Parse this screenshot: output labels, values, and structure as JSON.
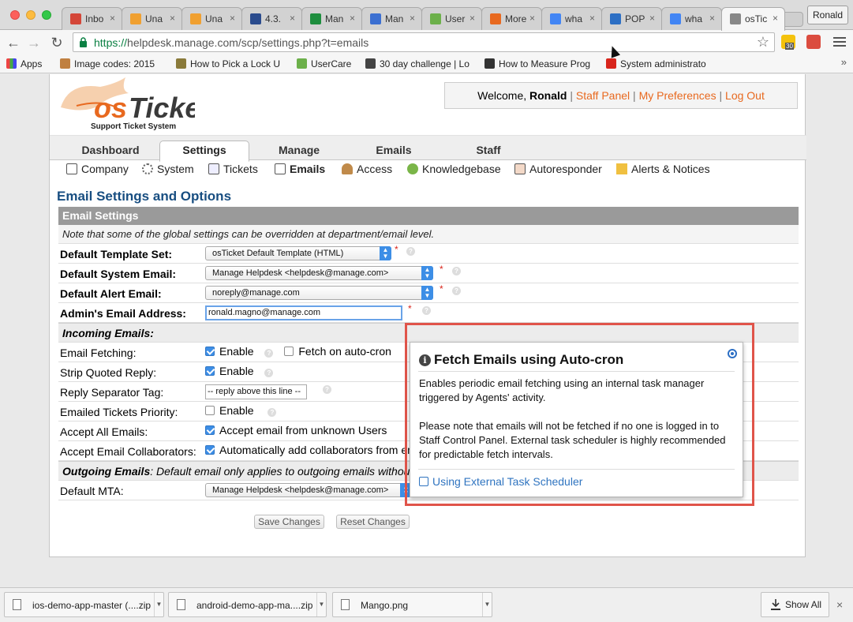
{
  "browser": {
    "tabs": [
      {
        "label": "Inbo",
        "favicon": "gmail-icon",
        "color": "#d44638"
      },
      {
        "label": "Una",
        "favicon": "edit-icon",
        "color": "#f0a030"
      },
      {
        "label": "Una",
        "favicon": "edit-icon",
        "color": "#f0a030"
      },
      {
        "label": "4.3.",
        "favicon": "x-icon",
        "color": "#2a4b8d"
      },
      {
        "label": "Man",
        "favicon": "sheets-icon",
        "color": "#1e8e3e"
      },
      {
        "label": "Man",
        "favicon": "calendar-icon",
        "color": "#3b6fd1"
      },
      {
        "label": "User",
        "favicon": "usercare-icon",
        "color": "#6cb04a"
      },
      {
        "label": "More",
        "favicon": "chart-icon",
        "color": "#e8691f"
      },
      {
        "label": "wha",
        "favicon": "google-icon",
        "color": "#4285f4"
      },
      {
        "label": "POP",
        "favicon": "pop-icon",
        "color": "#2d6fc4"
      },
      {
        "label": "wha",
        "favicon": "google-icon",
        "color": "#4285f4"
      },
      {
        "label": "osTic",
        "favicon": "doc-icon",
        "color": "#888888"
      }
    ],
    "tab_close": "×",
    "profile_name": "Ronald",
    "url_scheme": "https://",
    "url_rest": "helpdesk.manage.com/scp/settings.php?t=emails",
    "extension_badge": "30",
    "bookmarks": [
      {
        "label": "Apps"
      },
      {
        "label": "Image codes: 2015"
      },
      {
        "label": "How to Pick a Lock U"
      },
      {
        "label": "UserCare"
      },
      {
        "label": "30 day challenge | Lo"
      },
      {
        "label": "How to Measure Prog"
      },
      {
        "label": "System administrato"
      }
    ],
    "bookmarks_more": "»"
  },
  "header": {
    "logo_text": "osTicket",
    "logo_tagline": "Support Ticket System",
    "welcome_prefix": "Welcome, ",
    "user_name": "Ronald",
    "links": [
      "Staff Panel",
      "My Preferences",
      "Log Out"
    ],
    "separator": "|"
  },
  "nav": {
    "tabs": [
      "Dashboard",
      "Settings",
      "Manage",
      "Emails",
      "Staff"
    ],
    "active_tab": "Settings"
  },
  "subnav": {
    "items": [
      "Company",
      "System",
      "Tickets",
      "Emails",
      "Access",
      "Knowledgebase",
      "Autoresponder",
      "Alerts & Notices"
    ],
    "active": "Emails"
  },
  "page": {
    "title": "Email Settings and Options",
    "section_header": "Email Settings",
    "note": "Note that some of the global settings can be overridden at department/email level.",
    "fields": {
      "template_label": "Default Template Set:",
      "template_value": "osTicket Default Template (HTML)",
      "system_email_label": "Default System Email:",
      "system_email_value": "Manage Helpdesk <helpdesk@manage.com>",
      "alert_email_label": "Default Alert Email:",
      "alert_email_value": "noreply@manage.com",
      "admin_email_label": "Admin's Email Address:",
      "admin_email_value": "ronald.magno@manage.com"
    },
    "required_mark": "*",
    "help_mark": "?",
    "incoming_header": "Incoming Emails:",
    "incoming": {
      "fetching_label": "Email Fetching:",
      "fetching_enable": "Enable",
      "fetching_autocron": "Fetch on auto-cron",
      "strip_label": "Strip Quoted Reply:",
      "strip_enable": "Enable",
      "separator_label": "Reply Separator Tag:",
      "separator_value": "-- reply above this line --",
      "priority_label": "Emailed Tickets Priority:",
      "priority_enable": "Enable",
      "accept_all_label": "Accept All Emails:",
      "accept_all_text": "Accept email from unknown Users",
      "collab_label": "Accept Email Collaborators:",
      "collab_text": "Automatically add collaborators from email fields"
    },
    "outgoing_header": "Outgoing Emails",
    "outgoing_note": ": Default email only applies to outgoing emails without SMTP setting.",
    "mta_label": "Default MTA:",
    "mta_value": "Manage Helpdesk <helpdesk@manage.com>",
    "save_label": "Save Changes",
    "reset_label": "Reset Changes"
  },
  "popup": {
    "title": "Fetch Emails using Auto-cron",
    "p1": "Enables periodic email fetching using an internal task manager triggered by Agents' activity.",
    "p2": "Please note that emails will not be fetched if no one is logged in to Staff Control Panel. External task scheduler is highly recommended for predictable fetch intervals.",
    "link": "Using External Task Scheduler"
  },
  "downloads": {
    "items": [
      "ios-demo-app-master (....zip",
      "android-demo-app-ma....zip",
      "Mango.png"
    ],
    "show_all": "Show All",
    "close": "×"
  },
  "colors": {
    "accent_orange": "#e8691f",
    "title_blue": "#184e81",
    "highlight_red": "#e0544a",
    "checkbox_blue": "#3d8ee6"
  }
}
